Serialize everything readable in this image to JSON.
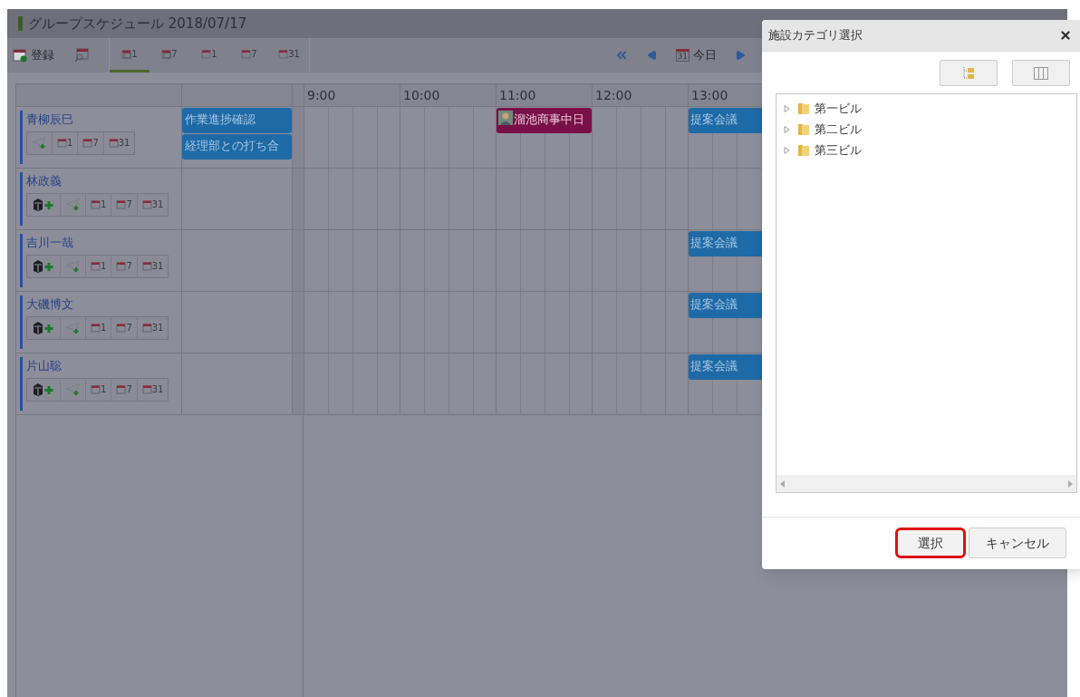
{
  "header": {
    "title": "グループスケジュール 2018/07/17"
  },
  "toolbar": {
    "register_label": "登録",
    "views": [
      {
        "kind": "group",
        "number": "1",
        "selected": true
      },
      {
        "kind": "group",
        "number": "7",
        "selected": false
      },
      {
        "kind": "single",
        "number": "1",
        "selected": false
      },
      {
        "kind": "single",
        "number": "7",
        "selected": false
      },
      {
        "kind": "month",
        "number": "31",
        "selected": false
      }
    ],
    "today_label": "今日",
    "today_number": "31"
  },
  "hours": [
    "9:00",
    "10:00",
    "11:00",
    "12:00",
    "13:00"
  ],
  "people": [
    {
      "name": "青柳辰巳",
      "buttons": [
        {
          "kind": "mail"
        },
        {
          "kind": "day",
          "number": "1"
        },
        {
          "kind": "week",
          "number": "7"
        },
        {
          "kind": "month",
          "number": "31"
        }
      ],
      "side_events": [
        "作業進捗確認",
        "経理部との打ち合"
      ],
      "slots": [
        {
          "kind": "empty"
        },
        {
          "kind": "empty"
        },
        {
          "kind": "visitor",
          "title": "溜池商事中日"
        },
        {
          "kind": "empty"
        },
        {
          "kind": "meeting",
          "title": "提案会議"
        }
      ]
    },
    {
      "name": "林政義",
      "buttons": [
        {
          "kind": "facility"
        },
        {
          "kind": "mail"
        },
        {
          "kind": "day",
          "number": "1"
        },
        {
          "kind": "week",
          "number": "7"
        },
        {
          "kind": "month",
          "number": "31"
        }
      ],
      "slots": [
        {
          "kind": "empty"
        },
        {
          "kind": "empty"
        },
        {
          "kind": "empty"
        },
        {
          "kind": "empty"
        },
        {
          "kind": "empty"
        }
      ]
    },
    {
      "name": "吉川一哉",
      "buttons": [
        {
          "kind": "facility"
        },
        {
          "kind": "mail"
        },
        {
          "kind": "day",
          "number": "1"
        },
        {
          "kind": "week",
          "number": "7"
        },
        {
          "kind": "month",
          "number": "31"
        }
      ],
      "slots": [
        {
          "kind": "empty"
        },
        {
          "kind": "empty"
        },
        {
          "kind": "empty"
        },
        {
          "kind": "empty"
        },
        {
          "kind": "meeting",
          "title": "提案会議"
        }
      ]
    },
    {
      "name": "大磯博文",
      "buttons": [
        {
          "kind": "facility"
        },
        {
          "kind": "mail"
        },
        {
          "kind": "day",
          "number": "1"
        },
        {
          "kind": "week",
          "number": "7"
        },
        {
          "kind": "month",
          "number": "31"
        }
      ],
      "slots": [
        {
          "kind": "empty"
        },
        {
          "kind": "empty"
        },
        {
          "kind": "empty"
        },
        {
          "kind": "empty"
        },
        {
          "kind": "meeting",
          "title": "提案会議"
        }
      ]
    },
    {
      "name": "片山聡",
      "buttons": [
        {
          "kind": "facility"
        },
        {
          "kind": "mail"
        },
        {
          "kind": "day",
          "number": "1"
        },
        {
          "kind": "week",
          "number": "7"
        },
        {
          "kind": "month",
          "number": "31"
        }
      ],
      "slots": [
        {
          "kind": "empty"
        },
        {
          "kind": "empty"
        },
        {
          "kind": "empty"
        },
        {
          "kind": "empty"
        },
        {
          "kind": "meeting",
          "title": "提案会議"
        }
      ]
    }
  ],
  "dialog": {
    "title": "施設カテゴリ選択",
    "tree": [
      {
        "label": "第一ビル",
        "expanded": false
      },
      {
        "label": "第二ビル",
        "expanded": false
      },
      {
        "label": "第三ビル",
        "expanded": false
      }
    ],
    "buttons": [
      {
        "label": "選択",
        "focused": true
      },
      {
        "label": "キャンセル",
        "focused": false
      }
    ]
  }
}
